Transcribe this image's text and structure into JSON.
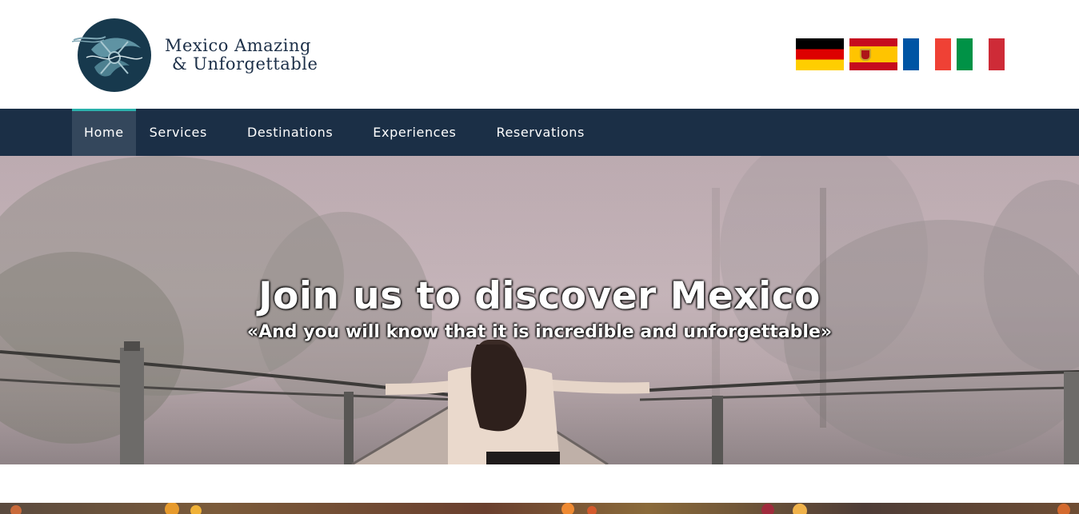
{
  "header": {
    "logo_line1": "Mexico Amazing",
    "logo_line2": "& Unforgettable",
    "languages": [
      "German",
      "Spanish",
      "French",
      "Italian"
    ]
  },
  "nav": {
    "items": [
      {
        "label": "Home",
        "active": true
      },
      {
        "label": "Services",
        "active": false
      },
      {
        "label": "Destinations",
        "active": false
      },
      {
        "label": "Experiences",
        "active": false
      },
      {
        "label": "Reservations",
        "active": false
      }
    ]
  },
  "hero": {
    "title": "Join us to discover Mexico",
    "subtitle": "«And you will know that it is incredible and unforgettable»"
  },
  "colors": {
    "nav_bg": "#1b2f46",
    "nav_active_bg": "#34475c",
    "nav_active_accent": "#2ab1ac",
    "logo_text": "#1c2f48",
    "logo_circle": "#17394d"
  }
}
